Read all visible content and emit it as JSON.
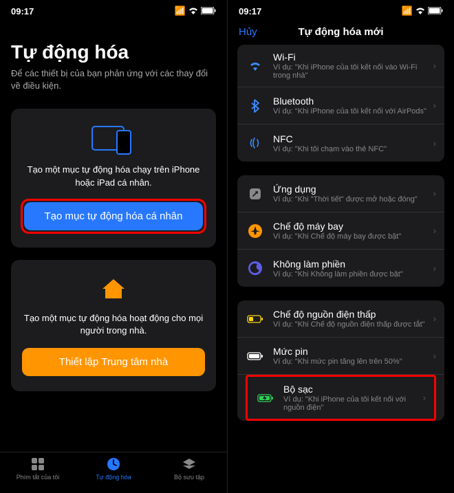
{
  "status": {
    "time": "09:17"
  },
  "left": {
    "title": "Tự động hóa",
    "subtitle": "Để các thiết bị của bạn phản ứng với các thay đổi về điều kiện.",
    "card1": {
      "desc": "Tạo một mục tự động hóa chạy trên iPhone hoặc iPad cá nhân.",
      "button": "Tạo mục tự động hóa cá nhân"
    },
    "card2": {
      "desc": "Tạo một mục tự động hóa hoạt động cho mọi người trong nhà.",
      "button": "Thiết lập Trung tâm nhà"
    },
    "tabs": {
      "shortcuts": "Phím tắt của tôi",
      "automation": "Tự động hóa",
      "gallery": "Bộ sưu tập"
    }
  },
  "right": {
    "cancel": "Hủy",
    "title": "Tự động hóa mới",
    "sections": [
      {
        "rows": [
          {
            "title": "Wi-Fi",
            "sub": "Ví dụ: \"Khi iPhone của tôi kết nối vào Wi-Fi trong nhà\"",
            "icon": "wifi"
          },
          {
            "title": "Bluetooth",
            "sub": "Ví dụ: \"Khi iPhone của tôi kết nối với AirPods\"",
            "icon": "bluetooth"
          },
          {
            "title": "NFC",
            "sub": "Ví dụ: \"Khi tôi chạm vào thẻ NFC\"",
            "icon": "nfc"
          }
        ]
      },
      {
        "rows": [
          {
            "title": "Ứng dụng",
            "sub": "Ví dụ: \"Khi \"Thời tiết\" được mở hoặc đóng\"",
            "icon": "app"
          },
          {
            "title": "Chế độ máy bay",
            "sub": "Ví dụ: \"Khi Chế độ máy bay được bật\"",
            "icon": "airplane"
          },
          {
            "title": "Không làm phiền",
            "sub": "Ví dụ: \"Khi Không làm phiền được bật\"",
            "icon": "dnd"
          }
        ]
      },
      {
        "rows": [
          {
            "title": "Chế độ nguồn điện thấp",
            "sub": "Ví dụ: \"Khi Chế độ nguồn điện thấp được tắt\"",
            "icon": "lowpower"
          },
          {
            "title": "Mức pin",
            "sub": "Ví dụ: \"Khi mức pin tăng lên trên 50%\"",
            "icon": "battery"
          },
          {
            "title": "Bộ sạc",
            "sub": "Ví dụ: \"Khi iPhone của tôi kết nối với nguồn điện\"",
            "icon": "charger",
            "highlight": true
          }
        ]
      }
    ]
  }
}
